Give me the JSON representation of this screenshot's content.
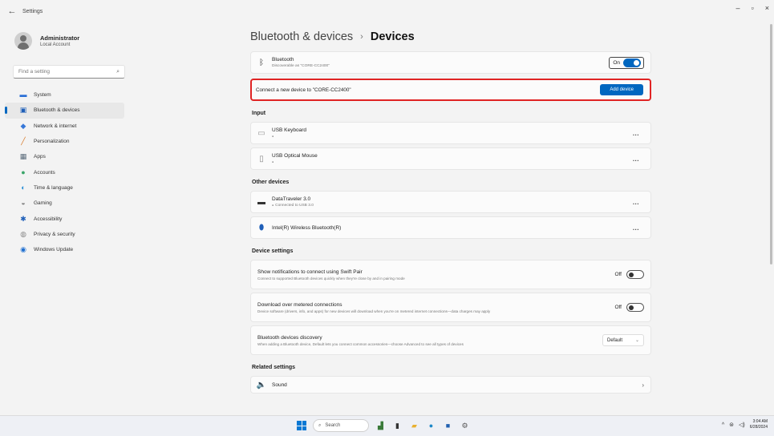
{
  "window": {
    "title": "Settings",
    "back_icon": "back-arrow-icon",
    "minimize": "–",
    "maximize": "▫",
    "close": "×"
  },
  "profile": {
    "name": "Administrator",
    "account_type": "Local Account"
  },
  "search": {
    "placeholder": "Find a setting"
  },
  "nav": [
    {
      "label": "System",
      "icon": "system-icon",
      "color": "#2b6fd6"
    },
    {
      "label": "Bluetooth & devices",
      "icon": "bluetooth-icon",
      "color": "#1f5fb8"
    },
    {
      "label": "Network & internet",
      "icon": "network-icon",
      "color": "#3778d8"
    },
    {
      "label": "Personalization",
      "icon": "brush-icon",
      "color": "#d77b2a"
    },
    {
      "label": "Apps",
      "icon": "apps-icon",
      "color": "#5a6a7a"
    },
    {
      "label": "Accounts",
      "icon": "accounts-icon",
      "color": "#3aa56a"
    },
    {
      "label": "Time & language",
      "icon": "globe-icon",
      "color": "#2b8fd6"
    },
    {
      "label": "Gaming",
      "icon": "gamepad-icon",
      "color": "#7a7a7a"
    },
    {
      "label": "Accessibility",
      "icon": "accessibility-icon",
      "color": "#1f5fb8"
    },
    {
      "label": "Privacy & security",
      "icon": "shield-icon",
      "color": "#7a7a7a"
    },
    {
      "label": "Windows Update",
      "icon": "update-icon",
      "color": "#1f6fd0"
    }
  ],
  "breadcrumb": {
    "parent": "Bluetooth & devices",
    "separator": "›",
    "current": "Devices"
  },
  "bluetooth": {
    "title": "Bluetooth",
    "subtitle": "Discoverable as \"CORE-CC2400\"",
    "toggle_state": "On"
  },
  "connect": {
    "text": "Connect a new device to \"CORE-CC2400\"",
    "button": "Add device"
  },
  "sections": {
    "input": "Input",
    "other": "Other devices",
    "device_settings": "Device settings",
    "related": "Related settings"
  },
  "input_devices": [
    {
      "name": "USB Keyboard",
      "icon": "keyboard-icon"
    },
    {
      "name": "USB Optical Mouse",
      "icon": "mouse-icon"
    }
  ],
  "other_devices": [
    {
      "name": "DataTraveler 3.0",
      "status": "Connected to USB 3.0",
      "icon": "usb-drive-icon"
    },
    {
      "name": "Intel(R) Wireless Bluetooth(R)",
      "status": "",
      "icon": "bluetooth-device-icon"
    }
  ],
  "device_settings": [
    {
      "title": "Show notifications to connect using Swift Pair",
      "desc": "Connect to supported Bluetooth devices quickly when they're close by and in pairing mode",
      "control": "toggle",
      "state": "Off"
    },
    {
      "title": "Download over metered connections",
      "desc": "Device software (drivers, info, and apps) for new devices will download when you're on metered internet connections—data charges may apply",
      "control": "toggle",
      "state": "Off"
    },
    {
      "title": "Bluetooth devices discovery",
      "desc": "When adding a Bluetooth device, Default lets you connect common accessories—choose Advanced to see all types of devices",
      "control": "dropdown",
      "state": "Default"
    }
  ],
  "related_settings": [
    {
      "label": "Sound",
      "icon": "speaker-icon"
    }
  ],
  "ellipsis": "...",
  "taskbar": {
    "search_placeholder": "Search",
    "time": "3:04 AM",
    "date": "6/28/2024"
  }
}
